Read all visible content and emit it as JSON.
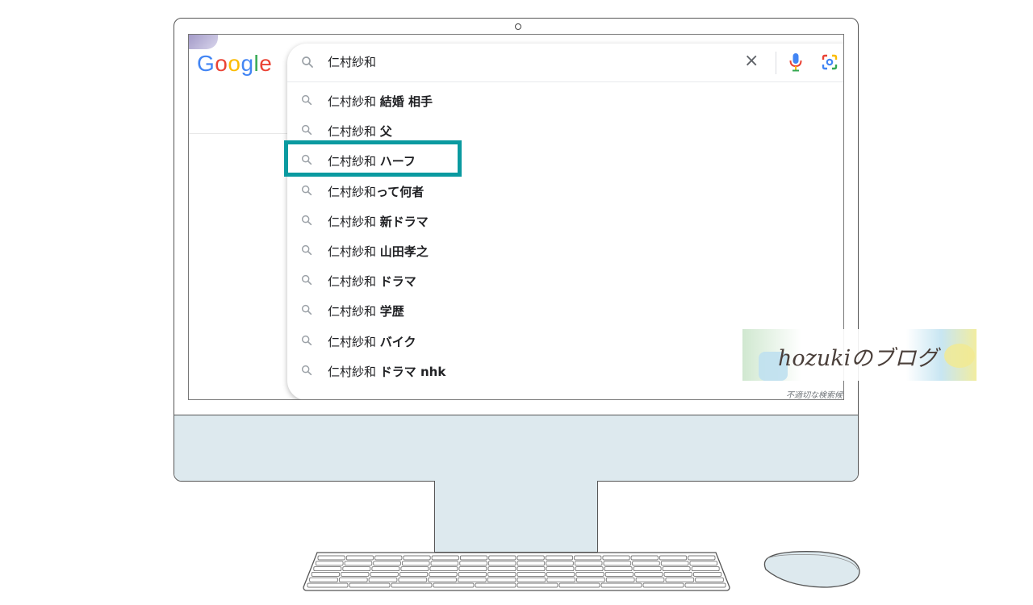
{
  "search": {
    "query": "仁村紗和",
    "clear_label": "×"
  },
  "google_logo": {
    "letters": [
      "G",
      "o",
      "o",
      "g",
      "l",
      "e"
    ]
  },
  "suggestions": [
    {
      "prefix": "仁村紗和 ",
      "bold": "結婚 相手"
    },
    {
      "prefix": "仁村紗和 ",
      "bold": "父"
    },
    {
      "prefix": "仁村紗和 ",
      "bold": "ハーフ"
    },
    {
      "prefix": "仁村紗和",
      "bold": "って何者"
    },
    {
      "prefix": "仁村紗和 ",
      "bold": "新ドラマ"
    },
    {
      "prefix": "仁村紗和 ",
      "bold": "山田孝之"
    },
    {
      "prefix": "仁村紗和 ",
      "bold": "ドラマ"
    },
    {
      "prefix": "仁村紗和 ",
      "bold": "学歴"
    },
    {
      "prefix": "仁村紗和 ",
      "bold": "バイク"
    },
    {
      "prefix": "仁村紗和 ",
      "bold": "ドラマ nhk"
    }
  ],
  "highlighted_suggestion_index": 2,
  "inappropriate_link": "不適切な検索候補",
  "watermark": "hozukiのブログ",
  "colors": {
    "highlight": "#0a9aa0",
    "chin": "#dde9ee"
  },
  "icons": [
    "search-icon",
    "close-icon",
    "microphone-icon",
    "google-lens-icon",
    "camera-dot-icon"
  ]
}
